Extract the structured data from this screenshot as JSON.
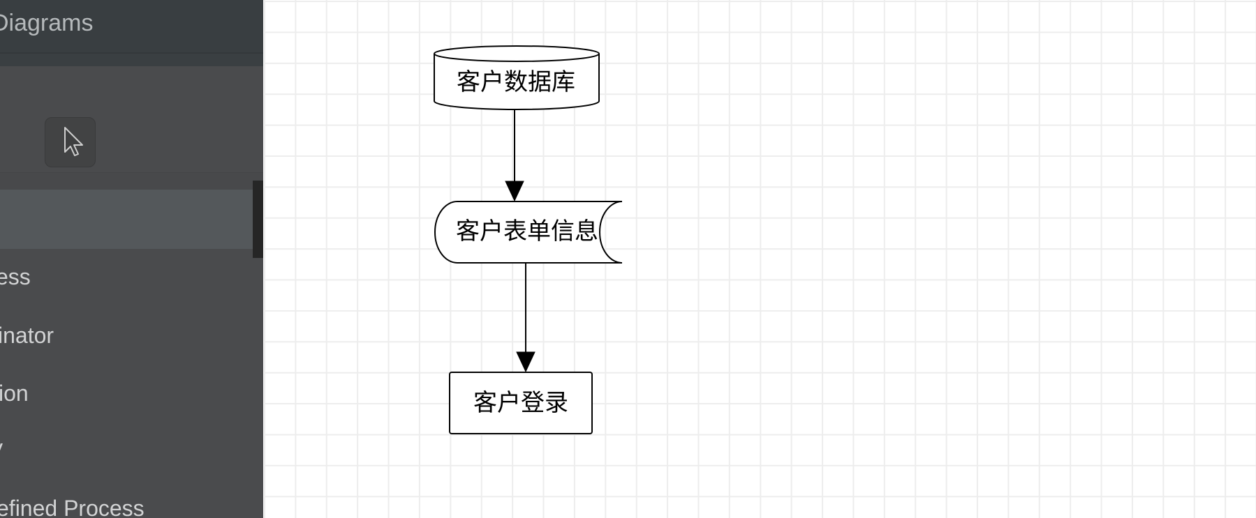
{
  "sidebar": {
    "title": "Diagrams",
    "tools": {
      "pointer": {
        "icon": "pointer-icon"
      }
    },
    "shape_items": [
      {
        "label": "ess"
      },
      {
        "label": "inator"
      },
      {
        "label": "ion"
      },
      {
        "label": "y"
      },
      {
        "label": "efined Process"
      }
    ]
  },
  "canvas": {
    "grid": true,
    "shapes": [
      {
        "id": "customer-database",
        "type": "cylinder",
        "label": "客户数据库"
      },
      {
        "id": "customer-form-info",
        "type": "stored-data",
        "label": "客户表单信息"
      },
      {
        "id": "customer-login",
        "type": "process",
        "label": "客户登录"
      }
    ],
    "connectors": [
      {
        "from": "customer-database",
        "to": "customer-form-info",
        "arrow": "block"
      },
      {
        "from": "customer-form-info",
        "to": "customer-login",
        "arrow": "block"
      }
    ]
  },
  "colors": {
    "header_bg": "#393e41",
    "sidebar_bg": "#4a4b4d",
    "highlight_bg": "#54585b",
    "scrollbar_thumb": "#262626",
    "tool_button_bg": "#424344",
    "canvas_bg": "#ffffff",
    "grid_line": "#ededed",
    "shape_stroke": "#000000",
    "shape_fill": "#ffffff",
    "sidebar_text": "#d2d3d4",
    "header_text": "#b6babc"
  }
}
